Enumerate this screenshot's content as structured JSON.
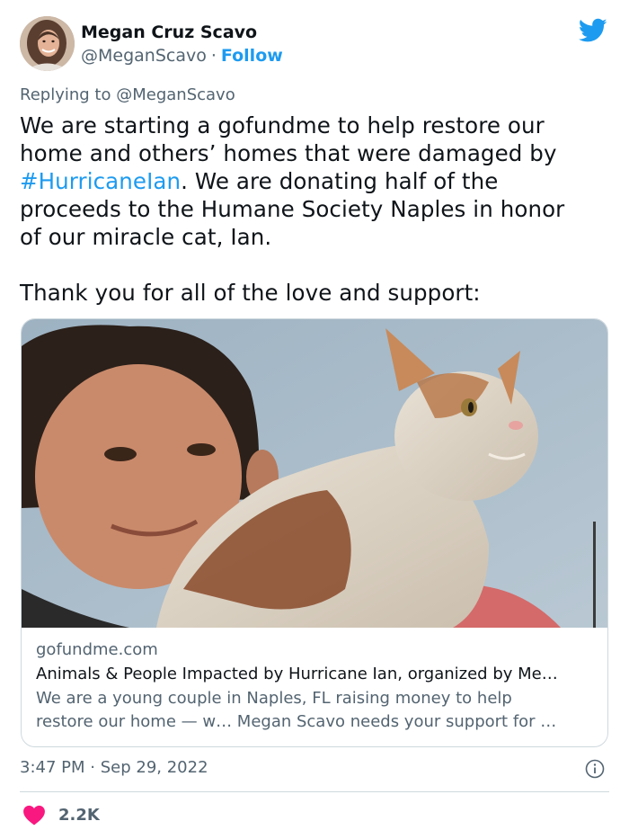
{
  "author": {
    "name": "Megan Cruz Scavo",
    "handle": "@MeganScavo",
    "separator": "·",
    "follow_label": "Follow",
    "avatar_icon": "user-avatar"
  },
  "brand": {
    "icon": "twitter-bird-icon",
    "color": "#1d9bf0"
  },
  "reply": {
    "prefix": "Replying to",
    "mention": "@MeganScavo"
  },
  "tweet": {
    "line1": "We are starting a gofundme to help restore our",
    "line2": "home and others’ homes that were damaged by",
    "hashtag": "#HurricaneIan",
    "line3_rest": ". We are donating half of the",
    "line4": "proceeds to the Humane Society Naples in honor",
    "line5": "of our miracle cat, Ian.",
    "line6": "Thank you for all of the love and support:"
  },
  "card": {
    "domain": "gofundme.com",
    "title": "Animals & People Impacted by Hurricane Ian, organized by Me…",
    "desc_line1": "We are a young couple in Naples, FL raising money to help",
    "desc_line2": "restore our home — w… Megan Scavo needs your support for …"
  },
  "meta": {
    "time": "3:47 PM",
    "separator": "·",
    "date": "Sep 29, 2022",
    "info_icon": "info-icon"
  },
  "engagement": {
    "like_icon": "heart-icon",
    "like_color": "#f91880",
    "likes": "2.2K"
  }
}
